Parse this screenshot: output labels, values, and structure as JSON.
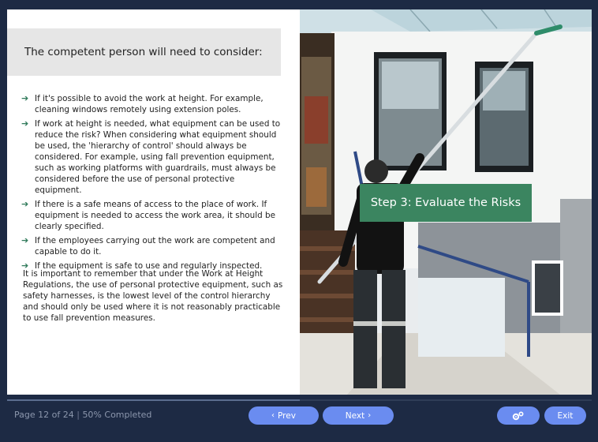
{
  "content": {
    "heading": "The competent person will need to consider:",
    "bullets": [
      "If it's possible to avoid the work at height. For example, cleaning windows remotely using extension poles.",
      "If work at height is needed, what equipment can be used to reduce the risk? When considering what equipment should be used, the 'hierarchy of control' should always be considered. For example, using fall prevention equipment, such as working platforms with guardrails, must always be considered before the use of personal protective equipment.",
      "If there is a safe means of access to the place of work. If equipment is needed to access the work area, it should be clearly specified.",
      "If the employees carrying out the work are competent and capable to do it.",
      "If the equipment is safe to use and regularly inspected."
    ],
    "paragraph": "It is important to remember that under the Work at Height Regulations, the use of personal protective equipment, such as safety harnesses, is the lowest level of the control hierarchy and should only be used where it is not reasonably practicable to use fall prevention measures."
  },
  "image": {
    "banner": "Step 3: Evaluate the Risks"
  },
  "footer": {
    "page_label": "Page 12 of 24",
    "separator": "|",
    "completed": "50% Completed",
    "progress_fraction": 0.5,
    "prev_label": "Prev",
    "next_label": "Next",
    "exit_label": "Exit",
    "settings_icon": "gears-icon"
  },
  "colors": {
    "background": "#1d2a44",
    "button": "#6a8cf0",
    "banner": "#3b8560",
    "arrow": "#2f7a5a"
  }
}
